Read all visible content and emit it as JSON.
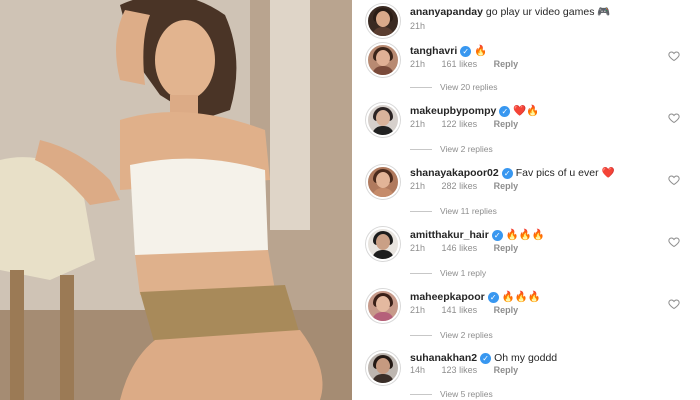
{
  "photo": {
    "description_icon": "portrait-photo"
  },
  "top_comment": {
    "username": "ananyapanday",
    "text": "go play ur video games 🎮",
    "time": "21h"
  },
  "comments": [
    {
      "username": "tanghavri",
      "verified": true,
      "text": "🔥",
      "time": "21h",
      "likes": "161 likes",
      "reply": "Reply",
      "view_replies": "View 20 replies"
    },
    {
      "username": "makeupbypompy",
      "verified": true,
      "text": "❤️🔥",
      "time": "21h",
      "likes": "122 likes",
      "reply": "Reply",
      "view_replies": "View 2 replies"
    },
    {
      "username": "shanayakapoor02",
      "verified": true,
      "text": "Fav pics of u ever ❤️",
      "time": "21h",
      "likes": "282 likes",
      "reply": "Reply",
      "view_replies": "View 11 replies"
    },
    {
      "username": "amitthakur_hair",
      "verified": true,
      "text": "🔥🔥🔥",
      "time": "21h",
      "likes": "146 likes",
      "reply": "Reply",
      "view_replies": "View 1 reply"
    },
    {
      "username": "maheepkapoor",
      "verified": true,
      "text": "🔥🔥🔥",
      "time": "21h",
      "likes": "141 likes",
      "reply": "Reply",
      "view_replies": "View 2 replies"
    },
    {
      "username": "suhanakhan2",
      "verified": true,
      "text": "Oh my goddd",
      "time": "14h",
      "likes": "123 likes",
      "reply": "Reply",
      "view_replies": "View 5 replies"
    }
  ],
  "colors": {
    "verified": "#3897f0",
    "muted": "#8e8e8e",
    "text": "#262626",
    "heart": "#e0245e"
  }
}
